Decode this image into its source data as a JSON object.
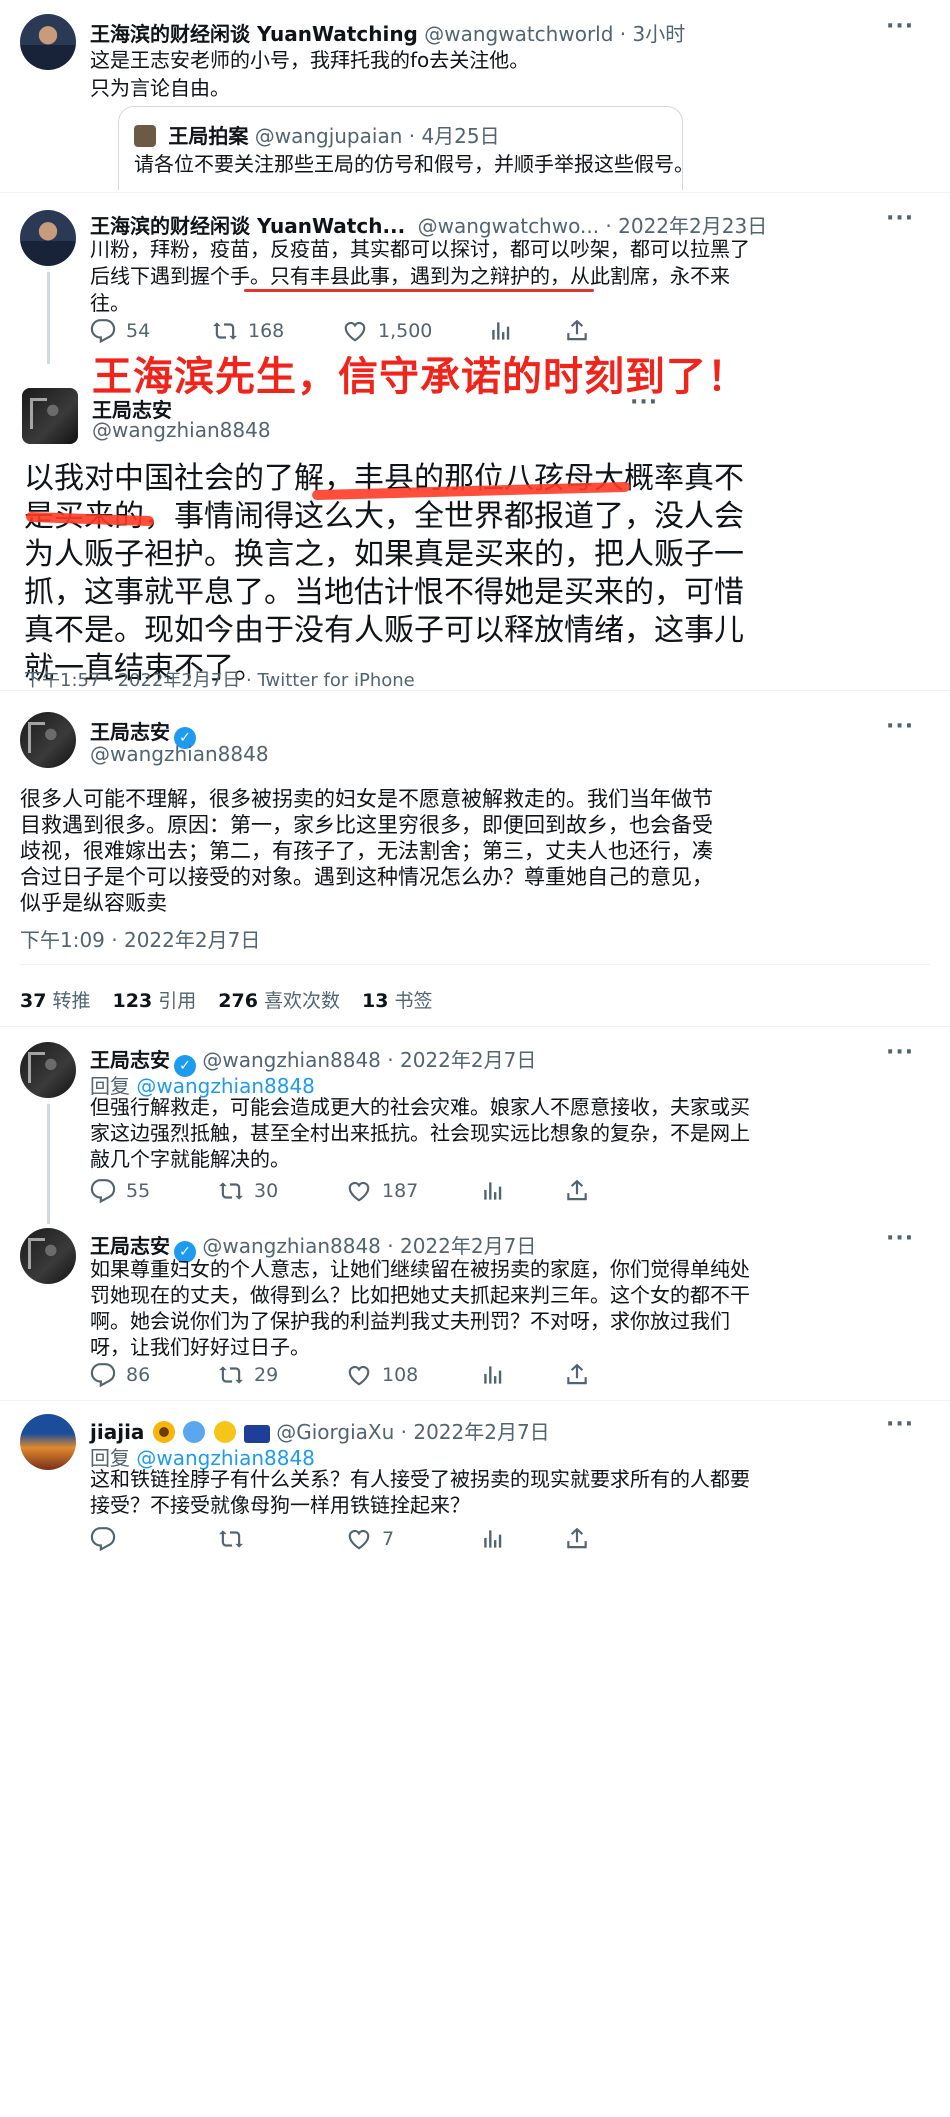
{
  "t1": {
    "name": "王海滨的财经闲谈 YuanWatching",
    "handle": "@wangwatchworld",
    "time": "· 3小时",
    "text1": "这是王志安老师的小号，我拜托我的fo去关注他。",
    "text2": "只为言论自由。",
    "quote": {
      "name": "王局拍案",
      "handle": "@wangjupaian",
      "time": "· 4月25日",
      "text": "请各位不要关注那些王局的仿号和假号，并顺手举报这些假号。"
    }
  },
  "t2": {
    "name": "王海滨的财经闲谈 YuanWatch...",
    "handle": "@wangwatchwo...",
    "time": "· 2022年2月23日",
    "line1": "川粉，拜粉，疫苗，反疫苗，其实都可以探讨，都可以吵架，都可以拉黑了",
    "line2a": "后线下遇到握个手。",
    "line2b": "只有丰县此事，遇到为之辩护的，从此割席，",
    "line2c": "永不来",
    "line3": "往。",
    "replies": "54",
    "retweets": "168",
    "likes": "1,500"
  },
  "banner": "王海滨先生，信守承诺的时刻到了！",
  "t3": {
    "name": "王局志安",
    "handle": "@wangzhian8848",
    "lines": [
      "以我对中国社会的了解，丰县的那位八孩母大概率真不",
      "是买来的，事情闹得这么大，全世界都报道了，没人会",
      "为人贩子袒护。换言之，如果真是买来的，把人贩子一",
      "抓，这事就平息了。当地估计恨不得她是买来的，可惜",
      "真不是。现如今由于没有人贩子可以释放情绪，这事儿",
      "就一直结束不了。"
    ],
    "meta": "下午1:57 · 2022年2月7日 · Twitter for iPhone"
  },
  "t4": {
    "name": "王局志安",
    "handle": "@wangzhian8848",
    "lines": [
      "很多人可能不理解，很多被拐卖的妇女是不愿意被解救走的。我们当年做节",
      "目救遇到很多。原因：第一，家乡比这里穷很多，即便回到故乡，也会备受",
      "歧视，很难嫁出去；第二，有孩子了，无法割舍；第三，丈夫人也还行，凑",
      "合过日子是个可以接受的对象。遇到这种情况怎么办？尊重她自己的意见，",
      "似乎是纵容贩卖"
    ],
    "meta": "下午1:09 · 2022年2月7日",
    "stats": [
      {
        "num": "37",
        "label": "转推"
      },
      {
        "num": "123",
        "label": "引用"
      },
      {
        "num": "276",
        "label": "喜欢次数"
      },
      {
        "num": "13",
        "label": "书签"
      }
    ]
  },
  "t5": {
    "name": "王局志安",
    "handle": "@wangzhian8848",
    "time": "· 2022年2月7日",
    "reply_prefix": "回复",
    "reply_to": "@wangzhian8848",
    "lines": [
      "但强行解救走，可能会造成更大的社会灾难。娘家人不愿意接收，夫家或买",
      "家这边强烈抵触，甚至全村出来抵抗。社会现实远比想象的复杂，不是网上",
      "敲几个字就能解决的。"
    ],
    "replies": "55",
    "retweets": "30",
    "likes": "187"
  },
  "t6": {
    "name": "王局志安",
    "handle": "@wangzhian8848",
    "time": "· 2022年2月7日",
    "lines": [
      "如果尊重妇女的个人意志，让她们继续留在被拐卖的家庭，你们觉得单纯处",
      "罚她现在的丈夫，做得到么？比如把她丈夫抓起来判三年。这个女的都不干",
      "啊。她会说你们为了保护我的利益判我丈夫刑罚？不对呀，求你放过我们",
      "呀，让我们好好过日子。"
    ],
    "replies": "86",
    "retweets": "29",
    "likes": "108"
  },
  "t7": {
    "name": "jiajia",
    "handle": "@GiorgiaXu",
    "time": "· 2022年2月7日",
    "reply_prefix": "回复",
    "reply_to": "@wangzhian8848",
    "lines": [
      "这和铁链拴脖子有什么关系？有人接受了被拐卖的现实就要求所有的人都要",
      "接受？不接受就像母狗一样用铁链拴起来？"
    ],
    "likes": "7"
  },
  "icons": [
    "reply-icon",
    "retweet-icon",
    "like-icon",
    "analytics-icon",
    "share-icon",
    "more-icon",
    "verified-icon"
  ],
  "colors": {
    "accent": "#1d9bf0",
    "highlight": "#e8322c",
    "muted": "#536471"
  }
}
